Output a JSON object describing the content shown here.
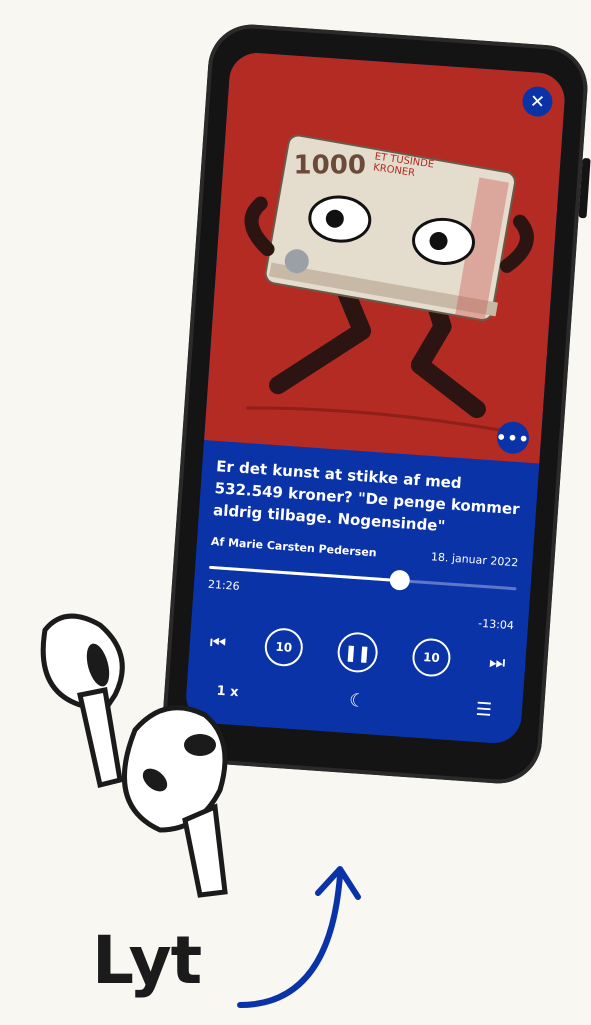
{
  "art": {
    "banknote_denomination": "1000",
    "banknote_text_line1": "ET TUSINDE",
    "banknote_text_line2": "KRONER"
  },
  "player": {
    "close_icon": "close-icon",
    "more_icon": "more-icon",
    "title": "Er det kunst at stikke af med 532.549 kroner?  \"De penge kommer aldrig tilbage. Nogensinde\"",
    "author": "Af Marie Carsten Pedersen",
    "date": "18. januar 2022",
    "elapsed": "21:26",
    "remaining": "-13:04",
    "progress_fraction": 0.62,
    "skip_back_seconds": "10",
    "skip_forward_seconds": "10",
    "speed": "1 x"
  },
  "cta": {
    "label": "Lyt"
  },
  "colors": {
    "background": "#f8f7f1",
    "phone": "#141414",
    "art_red": "#b42b23",
    "player_blue": "#0b33a8",
    "arrow_blue": "#0b33a8"
  }
}
